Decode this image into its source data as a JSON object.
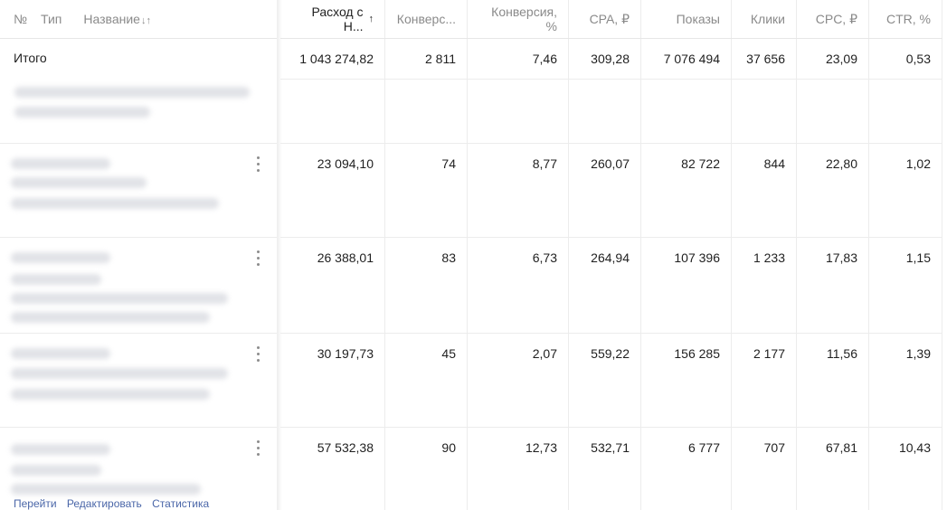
{
  "header": {
    "num": "№",
    "type": "Тип",
    "name": "Название",
    "name_sort_icon": "↓↑",
    "columns": [
      "Расход с Н...",
      "Конверс...",
      "Конверсия, %",
      "CPA, ₽",
      "Показы",
      "Клики",
      "CPC, ₽",
      "CTR, %"
    ],
    "active_sort_icon": "↑"
  },
  "total": {
    "label": "Итого",
    "values": [
      "1 043 274,82",
      "2 811",
      "7,46",
      "309,28",
      "7 076 494",
      "37 656",
      "23,09",
      "0,53"
    ]
  },
  "rows": [
    {
      "values": [
        "",
        "",
        "",
        "",
        "",
        "",
        "",
        ""
      ]
    },
    {
      "values": [
        "23 094,10",
        "74",
        "8,77",
        "260,07",
        "82 722",
        "844",
        "22,80",
        "1,02"
      ]
    },
    {
      "values": [
        "26 388,01",
        "83",
        "6,73",
        "264,94",
        "107 396",
        "1 233",
        "17,83",
        "1,15"
      ]
    },
    {
      "values": [
        "30 197,73",
        "45",
        "2,07",
        "559,22",
        "156 285",
        "2 177",
        "11,56",
        "1,39"
      ]
    },
    {
      "values": [
        "57 532,38",
        "90",
        "12,73",
        "532,71",
        "6 777",
        "707",
        "67,81",
        "10,43"
      ]
    }
  ],
  "actions": {
    "go": "Перейти",
    "edit": "Редактировать",
    "stats": "Статистика"
  }
}
